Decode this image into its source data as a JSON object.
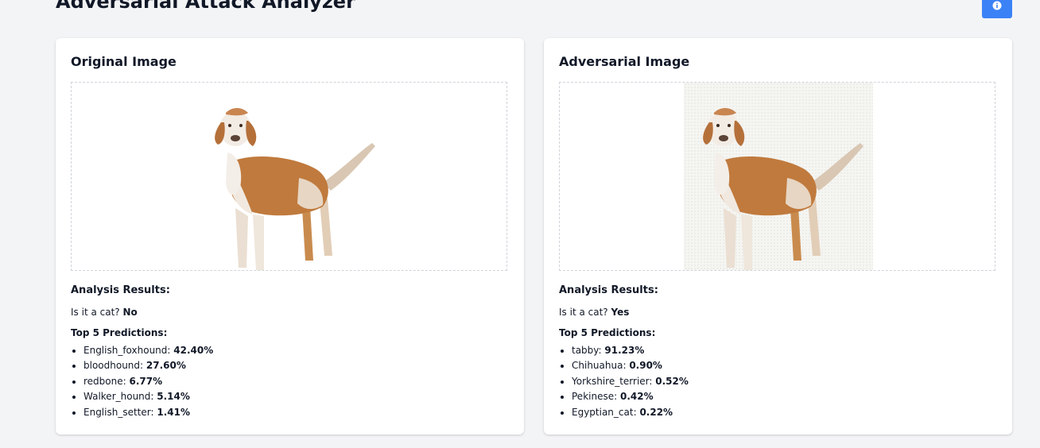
{
  "app": {
    "title": "Adversarial Attack Analyzer"
  },
  "header": {
    "info_icon": "info-circle-icon",
    "accent_color": "#3b82f6"
  },
  "panels": {
    "original": {
      "title": "Original Image",
      "results_heading": "Analysis Results:",
      "is_cat_label": "Is it a cat?",
      "is_cat_value": "No",
      "predictions_heading": "Top 5 Predictions:",
      "predictions": [
        {
          "label": "English_foxhound",
          "value": "42.40%"
        },
        {
          "label": "bloodhound",
          "value": "27.60%"
        },
        {
          "label": "redbone",
          "value": "6.77%"
        },
        {
          "label": "Walker_hound",
          "value": "5.14%"
        },
        {
          "label": "English_setter",
          "value": "1.41%"
        }
      ]
    },
    "adversarial": {
      "title": "Adversarial Image",
      "results_heading": "Analysis Results:",
      "is_cat_label": "Is it a cat?",
      "is_cat_value": "Yes",
      "predictions_heading": "Top 5 Predictions:",
      "predictions": [
        {
          "label": "tabby",
          "value": "91.23%"
        },
        {
          "label": "Chihuahua",
          "value": "0.90%"
        },
        {
          "label": "Yorkshire_terrier",
          "value": "0.52%"
        },
        {
          "label": "Pekinese",
          "value": "0.42%"
        },
        {
          "label": "Egyptian_cat",
          "value": "0.22%"
        }
      ]
    }
  }
}
